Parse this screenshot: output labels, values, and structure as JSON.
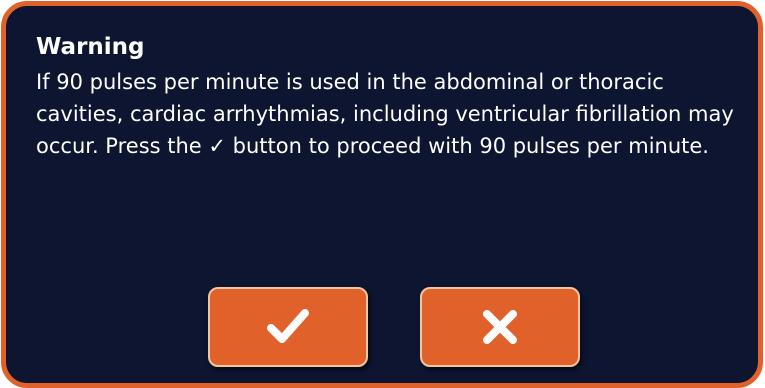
{
  "dialog": {
    "title": "Warning",
    "message": "If 90 pulses per minute is used in the abdominal or thoracic cavities, cardiac arrhythmias, including ventricular fibrillation may occur.  Press the ✓ button to proceed with 90 pulses per minute.",
    "confirm_icon": "checkmark-icon",
    "cancel_icon": "x-icon"
  },
  "colors": {
    "background": "#0d1530",
    "accent": "#e0622a",
    "button_border": "#f2c6a0",
    "text": "#ffffff"
  }
}
